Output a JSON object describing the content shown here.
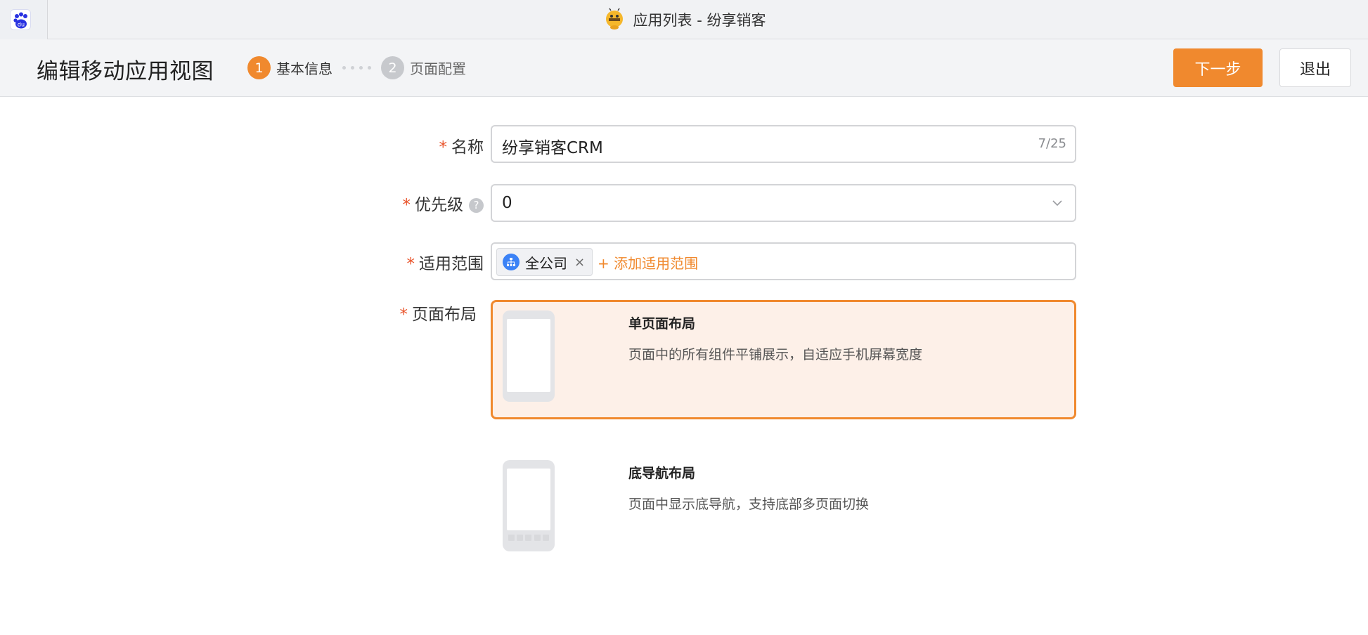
{
  "window": {
    "title": "应用列表 - 纷享销客"
  },
  "header": {
    "page_title": "编辑移动应用视图",
    "steps": [
      {
        "num": "1",
        "label": "基本信息"
      },
      {
        "num": "2",
        "label": "页面配置"
      }
    ],
    "next_label": "下一步",
    "exit_label": "退出"
  },
  "form": {
    "required_mark": "*",
    "name": {
      "label": "名称",
      "value": "纷享销客CRM",
      "counter": "7/25"
    },
    "priority": {
      "label": "优先级",
      "help": "?",
      "value": "0"
    },
    "scope": {
      "label": "适用范围",
      "tag": "全公司",
      "tag_close": "×",
      "add_label": "+ 添加适用范围"
    },
    "layout": {
      "label": "页面布局",
      "options": [
        {
          "title": "单页面布局",
          "desc": "页面中的所有组件平铺展示，自适应手机屏幕宽度",
          "selected": true
        },
        {
          "title": "底导航布局",
          "desc": "页面中显示底导航，支持底部多页面切换",
          "selected": false
        }
      ]
    }
  },
  "colors": {
    "accent": "#f0892e",
    "required": "#e9542b",
    "selected_bg": "#fdf0e8"
  }
}
